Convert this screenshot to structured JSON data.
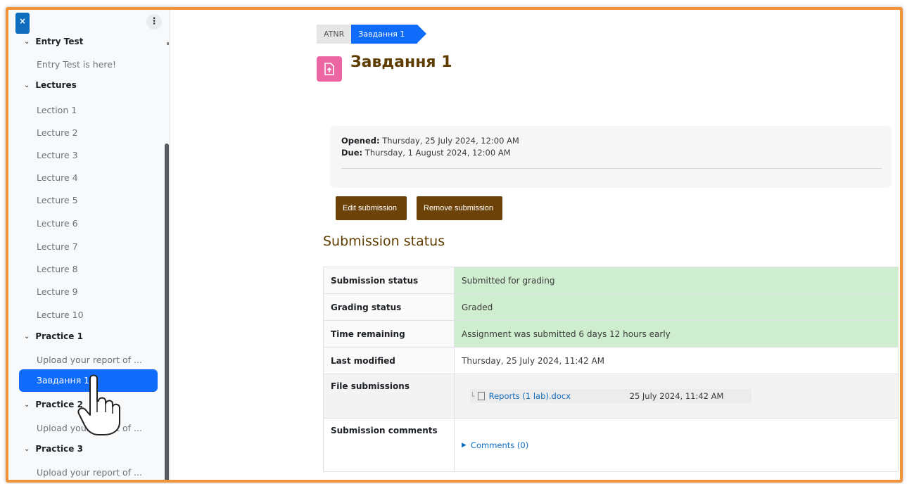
{
  "sidebar": {
    "close_label": "×",
    "menu_label": "⋮",
    "sections": [
      {
        "label": "Entry Test",
        "items": [
          "Entry Test is here!"
        ]
      },
      {
        "label": "Lectures",
        "items": [
          "Lection 1",
          "Lecture 2",
          "Lecture 3",
          "Lecture 4",
          "Lecture 5",
          "Lecture 6",
          "Lecture 7",
          "Lecture 8",
          "Lecture 9",
          "Lecture 10"
        ]
      },
      {
        "label": "Practice 1",
        "items": [
          "Upload your report of ...",
          "Завдання 1"
        ]
      },
      {
        "label": "Practice 2",
        "items": [
          "Upload your report of ..."
        ]
      },
      {
        "label": "Practice 3",
        "items": [
          "Upload your report of ..."
        ]
      }
    ],
    "active_item": "Завдання 1"
  },
  "breadcrumb": [
    "ATNR",
    "Завдання 1"
  ],
  "page": {
    "title": "Завдання 1",
    "icon": "assignment-upload-icon",
    "icon_color": "#eb66a2"
  },
  "dates": {
    "opened_label": "Opened:",
    "opened_value": "Thursday, 25 July 2024, 12:00 AM",
    "due_label": "Due:",
    "due_value": "Thursday, 1 August 2024, 12:00 AM"
  },
  "actions": {
    "edit": "Edit submission",
    "remove": "Remove submission"
  },
  "submission": {
    "heading": "Submission status",
    "rows": [
      {
        "label": "Submission status",
        "value": "Submitted for grading"
      },
      {
        "label": "Grading status",
        "value": "Graded"
      },
      {
        "label": "Time remaining",
        "value": "Assignment was submitted 6 days 12 hours early"
      },
      {
        "label": "Last modified",
        "value": "Thursday, 25 July 2024, 11:42 AM"
      },
      {
        "label": "File submissions",
        "file_name": "Reports (1 lab).docx",
        "file_date": "25 July 2024, 11:42 AM"
      },
      {
        "label": "Submission comments",
        "value": "Comments (0)"
      }
    ]
  },
  "colors": {
    "accent": "#0f6cfb",
    "brand_brown": "#6d4208",
    "success_bg": "#cfeecf",
    "frame_border": "#f0933a"
  }
}
